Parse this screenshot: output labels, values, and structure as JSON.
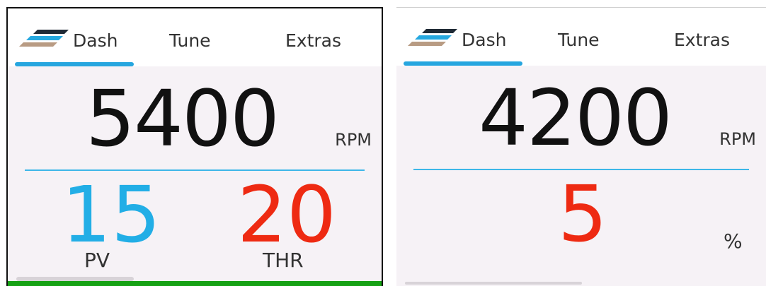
{
  "colors": {
    "accent": "#26a6df",
    "pv": "#22aee6",
    "thr": "#ee2a12",
    "status_ok": "#16a114",
    "panel_bg": "#f6f2f6"
  },
  "screens": [
    {
      "tabs": [
        {
          "label": "Dash",
          "icon": "stripes-logo-icon",
          "active": true
        },
        {
          "label": "Tune"
        },
        {
          "label": "Extras"
        }
      ],
      "rpm": {
        "value": "5400",
        "unit": "RPM"
      },
      "pv": {
        "value": "15",
        "label": "PV"
      },
      "thr": {
        "value": "20",
        "label": "THR"
      }
    },
    {
      "tabs": [
        {
          "label": "Dash",
          "icon": "stripes-logo-icon",
          "active": true
        },
        {
          "label": "Tune"
        },
        {
          "label": "Extras"
        }
      ],
      "rpm": {
        "value": "4200",
        "unit": "RPM"
      },
      "percent": {
        "value": "5",
        "unit": "%"
      }
    }
  ]
}
